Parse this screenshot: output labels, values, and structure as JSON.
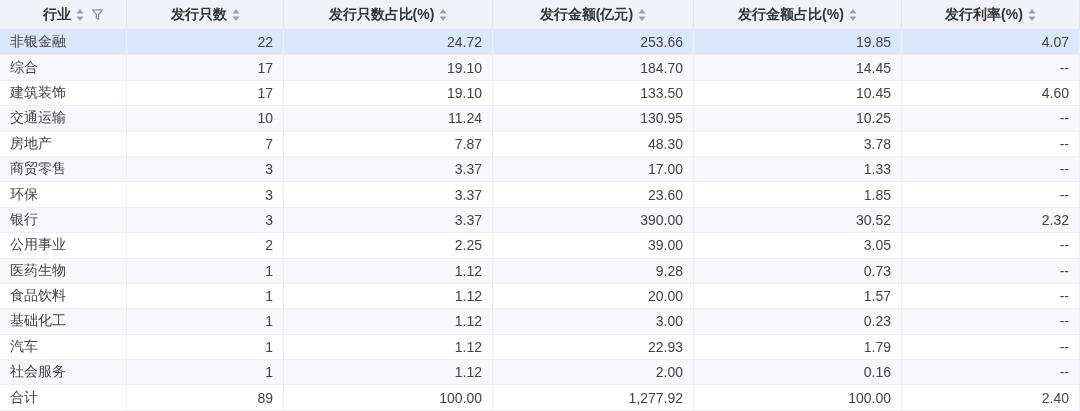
{
  "table": {
    "columns": [
      {
        "label": "行业"
      },
      {
        "label": "发行只数"
      },
      {
        "label": "发行只数占比(%)"
      },
      {
        "label": "发行金额(亿元)"
      },
      {
        "label": "发行金额占比(%)"
      },
      {
        "label": "发行利率(%)"
      }
    ],
    "rows": [
      {
        "selected": true,
        "cells": [
          "非银金融",
          "22",
          "24.72",
          "253.66",
          "19.85",
          "4.07"
        ]
      },
      {
        "selected": false,
        "cells": [
          "综合",
          "17",
          "19.10",
          "184.70",
          "14.45",
          "--"
        ]
      },
      {
        "selected": false,
        "cells": [
          "建筑装饰",
          "17",
          "19.10",
          "133.50",
          "10.45",
          "4.60"
        ]
      },
      {
        "selected": false,
        "cells": [
          "交通运输",
          "10",
          "11.24",
          "130.95",
          "10.25",
          "--"
        ]
      },
      {
        "selected": false,
        "cells": [
          "房地产",
          "7",
          "7.87",
          "48.30",
          "3.78",
          "--"
        ]
      },
      {
        "selected": false,
        "cells": [
          "商贸零售",
          "3",
          "3.37",
          "17.00",
          "1.33",
          "--"
        ]
      },
      {
        "selected": false,
        "cells": [
          "环保",
          "3",
          "3.37",
          "23.60",
          "1.85",
          "--"
        ]
      },
      {
        "selected": false,
        "cells": [
          "银行",
          "3",
          "3.37",
          "390.00",
          "30.52",
          "2.32"
        ]
      },
      {
        "selected": false,
        "cells": [
          "公用事业",
          "2",
          "2.25",
          "39.00",
          "3.05",
          "--"
        ]
      },
      {
        "selected": false,
        "cells": [
          "医药生物",
          "1",
          "1.12",
          "9.28",
          "0.73",
          "--"
        ]
      },
      {
        "selected": false,
        "cells": [
          "食品饮料",
          "1",
          "1.12",
          "20.00",
          "1.57",
          "--"
        ]
      },
      {
        "selected": false,
        "cells": [
          "基础化工",
          "1",
          "1.12",
          "3.00",
          "0.23",
          "--"
        ]
      },
      {
        "selected": false,
        "cells": [
          "汽车",
          "1",
          "1.12",
          "22.93",
          "1.79",
          "--"
        ]
      },
      {
        "selected": false,
        "cells": [
          "社会服务",
          "1",
          "1.12",
          "2.00",
          "0.16",
          "--"
        ]
      },
      {
        "selected": false,
        "cells": [
          "合计",
          "89",
          "100.00",
          "1,277.92",
          "100.00",
          "2.40"
        ]
      }
    ]
  }
}
